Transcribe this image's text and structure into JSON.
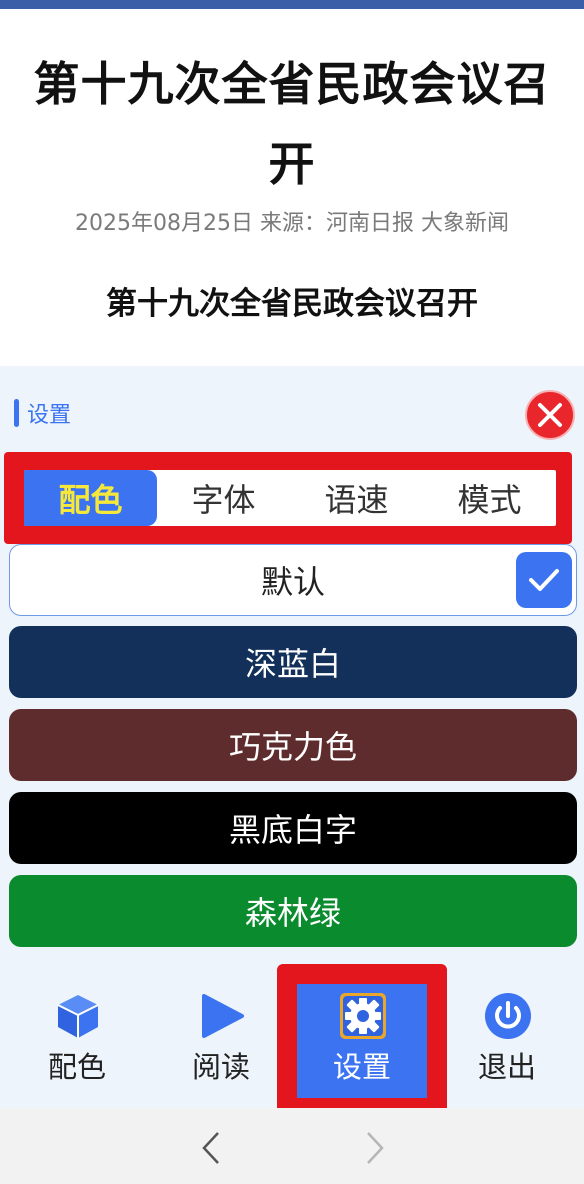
{
  "article": {
    "title": "第十九次全省民政会议召开",
    "meta": "2025年08月25日 来源：河南日报 大象新闻",
    "subtitle": "第十九次全省民政会议召开"
  },
  "settings": {
    "header": "设置",
    "tabs": [
      {
        "label": "配色",
        "active": true
      },
      {
        "label": "字体",
        "active": false
      },
      {
        "label": "语速",
        "active": false
      },
      {
        "label": "模式",
        "active": false
      }
    ],
    "options": [
      {
        "label": "默认",
        "selected": true,
        "bg": "#ffffff"
      },
      {
        "label": "深蓝白",
        "selected": false,
        "bg": "#12305a"
      },
      {
        "label": "巧克力色",
        "selected": false,
        "bg": "#5e2c2c"
      },
      {
        "label": "黑底白字",
        "selected": false,
        "bg": "#000000"
      },
      {
        "label": "森林绿",
        "selected": false,
        "bg": "#0a8b2e"
      }
    ]
  },
  "bottom_nav": {
    "items": [
      {
        "label": "配色",
        "icon": "cube-icon",
        "active": false
      },
      {
        "label": "阅读",
        "icon": "play-icon",
        "active": false
      },
      {
        "label": "设置",
        "icon": "gear-icon",
        "active": true
      },
      {
        "label": "退出",
        "icon": "power-icon",
        "active": false
      }
    ]
  },
  "colors": {
    "accent": "#3b73f0",
    "highlight_frame": "#e3161e",
    "active_tab_text": "#f5e83b",
    "panel_bg": "#eef4fb"
  }
}
